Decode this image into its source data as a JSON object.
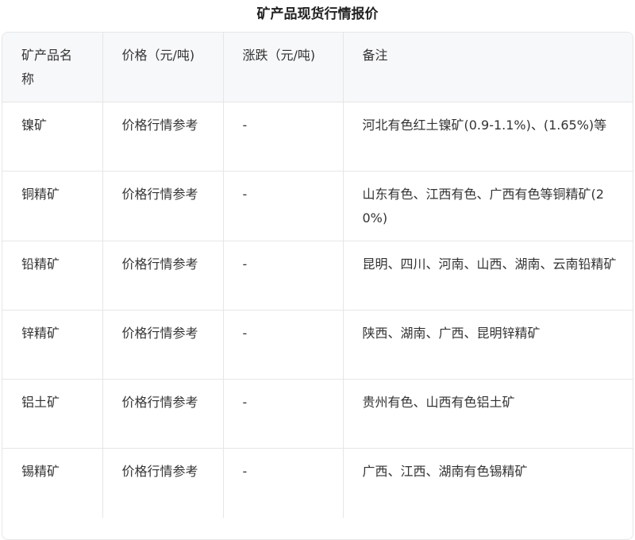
{
  "page": {
    "title": "矿产品现货行情报价"
  },
  "table": {
    "headers": [
      "矿产品名称",
      "价格（元/吨)",
      "涨跌（元/吨)",
      "备注"
    ],
    "rows": [
      [
        "镍矿",
        "价格行情参考",
        "-",
        "河北有色红土镍矿(0.9-1.1%)、(1.65%)等"
      ],
      [
        "铜精矿",
        "价格行情参考",
        "-",
        "山东有色、江西有色、广西有色等铜精矿(20%)"
      ],
      [
        "铅精矿",
        "价格行情参考",
        "-",
        "昆明、四川、河南、山西、湖南、云南铅精矿"
      ],
      [
        "锌精矿",
        "价格行情参考",
        "-",
        "陕西、湖南、广西、昆明锌精矿"
      ],
      [
        "铝土矿",
        "价格行情参考",
        "-",
        "贵州有色、山西有色铝土矿"
      ],
      [
        "锡精矿",
        "价格行情参考",
        "-",
        "广西、江西、湖南有色锡精矿"
      ]
    ]
  },
  "colors": {
    "header_bg": "#f7f8fa",
    "border": "#e6e6e6",
    "text": "#333333"
  }
}
